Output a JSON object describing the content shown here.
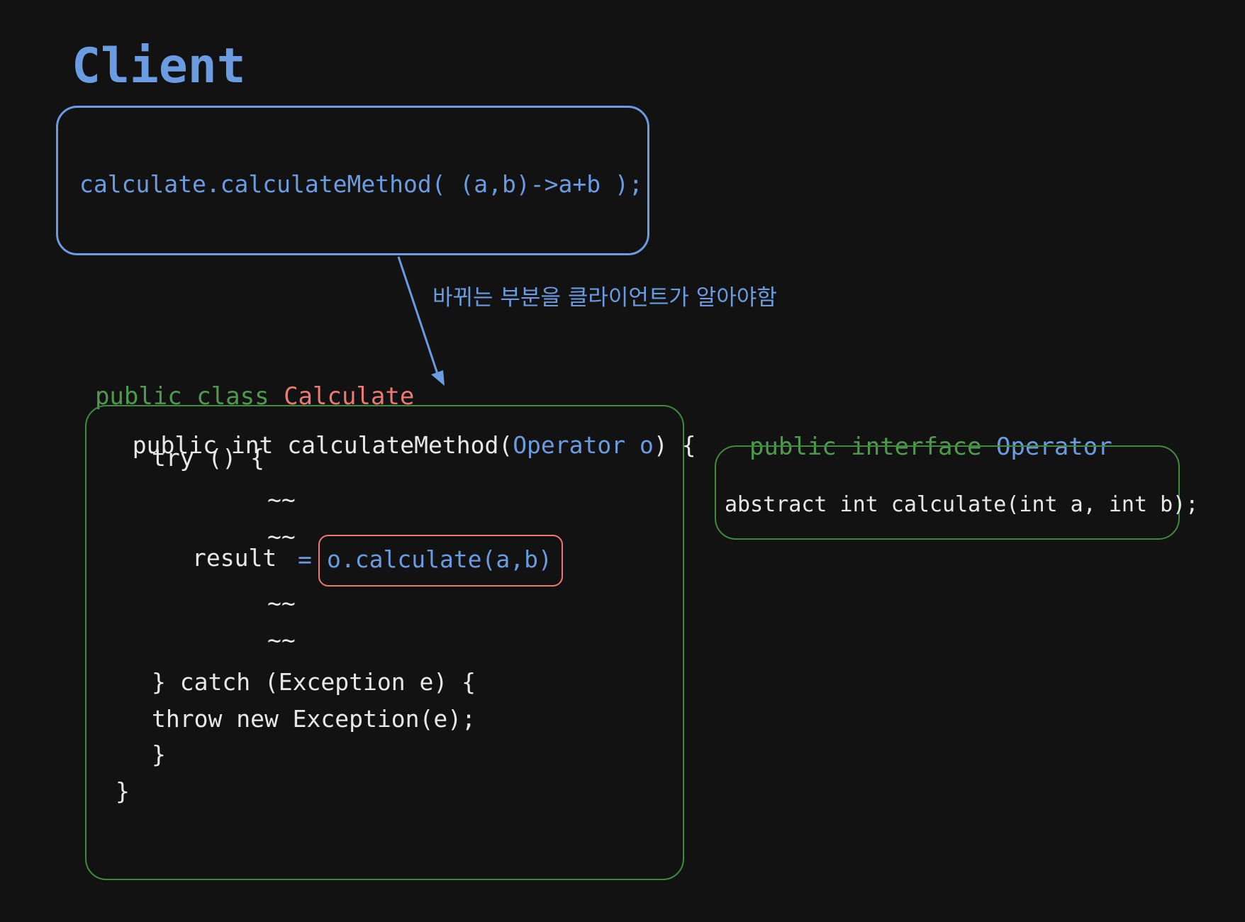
{
  "client": {
    "title": "Client",
    "code": "calculate.calculateMethod( (a,b)->a+b );"
  },
  "annotation": "바뀌는 부분을 클라이언트가 알아야함",
  "class_header": {
    "keywords": "public class ",
    "name": "Calculate"
  },
  "class_body": {
    "line1_prefix": "public int calculateMethod(",
    "line1_type": "Operator o",
    "line1_suffix": ") {",
    "line2": "try () {",
    "tilde": "~~",
    "result_label": "result",
    "result_equals": "=",
    "result_call": "o.calculate(a,b)",
    "catch_line": "} catch (Exception e) {",
    "throw_line": "throw new Exception(e);",
    "close_brace_inner": "}",
    "close_brace_outer": "}"
  },
  "interface_header": {
    "keywords": "public interface ",
    "name": "Operator"
  },
  "interface_body": {
    "code": "abstract int calculate(int a, int b);"
  },
  "colors": {
    "background": "#121212",
    "blue": "#6b9be0",
    "green": "#4e9a4e",
    "red": "#ec7a72",
    "white": "#e8e8e8"
  }
}
